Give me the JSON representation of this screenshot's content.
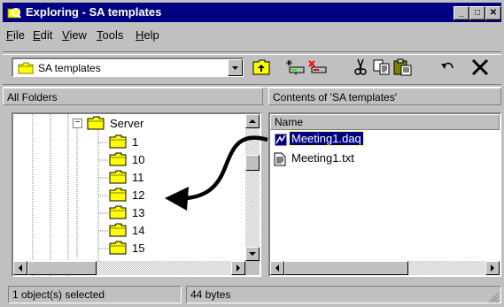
{
  "window": {
    "title": "Exploring - SA templates",
    "controls": {
      "minimize": "_",
      "maximize": "□",
      "close": "✕"
    }
  },
  "menu": [
    {
      "label": "File",
      "hotkey": "F",
      "rest": "ile"
    },
    {
      "label": "Edit",
      "hotkey": "E",
      "rest": "dit"
    },
    {
      "label": "View",
      "hotkey": "V",
      "rest": "iew"
    },
    {
      "label": "Tools",
      "hotkey": "T",
      "rest": "ools"
    },
    {
      "label": "Help",
      "hotkey": "H",
      "rest": "elp"
    }
  ],
  "address": {
    "value": "SA templates"
  },
  "toolbar": {
    "buttons": [
      "up-one-level-icon",
      "map-drive-icon",
      "disconnect-drive-icon",
      "cut-icon",
      "copy-icon",
      "paste-icon",
      "undo-icon",
      "delete-icon"
    ]
  },
  "panes": {
    "left_header": "All Folders",
    "right_header": "Contents of 'SA templates'"
  },
  "tree": {
    "parent": {
      "label": "Server",
      "expander": "−"
    },
    "children": [
      "1",
      "10",
      "11",
      "12",
      "13",
      "14",
      "15"
    ]
  },
  "list": {
    "column": "Name",
    "files": [
      {
        "name": "Meeting1.daq",
        "selected": true,
        "icon": "daq-file-icon"
      },
      {
        "name": "Meeting1.txt",
        "selected": false,
        "icon": "text-file-icon"
      }
    ]
  },
  "status": {
    "selection": "1 object(s) selected",
    "size": "44 bytes"
  },
  "colors": {
    "title_bar": "#000080",
    "selection": "#000080",
    "face": "#c0c0c0"
  }
}
